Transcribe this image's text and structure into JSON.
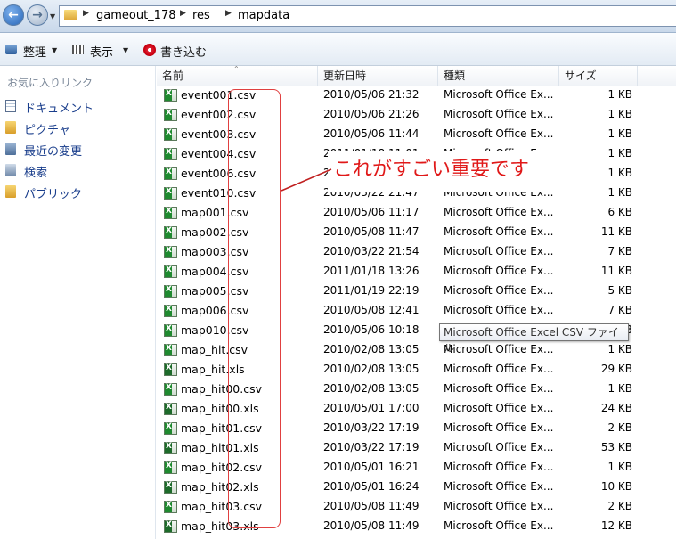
{
  "address": {
    "crumbs": [
      "gameout_178",
      "res",
      "mapdata"
    ]
  },
  "toolbar": {
    "organize_label": "整理",
    "view_label": "表示",
    "burn_label": "書き込む"
  },
  "navpane": {
    "heading": "お気に入りリンク",
    "items": [
      {
        "label": "ドキュメント",
        "icon": "document-icon"
      },
      {
        "label": "ピクチャ",
        "icon": "pictures-folder-icon"
      },
      {
        "label": "最近の変更",
        "icon": "recent-changes-icon"
      },
      {
        "label": "検索",
        "icon": "search-folder-icon"
      },
      {
        "label": "パブリック",
        "icon": "public-folder-icon"
      }
    ]
  },
  "columns": {
    "name": "名前",
    "date": "更新日時",
    "type": "種類",
    "size": "サイズ"
  },
  "files": [
    {
      "name": "event001.csv",
      "date": "2010/05/06 21:32",
      "type": "Microsoft Office Ex...",
      "size": "1 KB"
    },
    {
      "name": "event002.csv",
      "date": "2010/05/06 21:26",
      "type": "Microsoft Office Ex...",
      "size": "1 KB"
    },
    {
      "name": "event003.csv",
      "date": "2010/05/06 11:44",
      "type": "Microsoft Office Ex...",
      "size": "1 KB"
    },
    {
      "name": "event004.csv",
      "date": "2011/01/18 11:01",
      "type": "Microsoft Office Ex...",
      "size": "1 KB"
    },
    {
      "name": "event006.csv",
      "date": "2010/05/06 21:41",
      "type": "Microsoft Office Ex...",
      "size": "1 KB"
    },
    {
      "name": "event010.csv",
      "date": "2010/03/22 21:47",
      "type": "Microsoft Office Ex...",
      "size": "1 KB"
    },
    {
      "name": "map001.csv",
      "date": "2010/05/06 11:17",
      "type": "Microsoft Office Ex...",
      "size": "6 KB"
    },
    {
      "name": "map002.csv",
      "date": "2010/05/08 11:47",
      "type": "Microsoft Office Ex...",
      "size": "11 KB"
    },
    {
      "name": "map003.csv",
      "date": "2010/03/22 21:54",
      "type": "Microsoft Office Ex...",
      "size": "7 KB"
    },
    {
      "name": "map004.csv",
      "date": "2011/01/18 13:26",
      "type": "Microsoft Office Ex...",
      "size": "11 KB"
    },
    {
      "name": "map005.csv",
      "date": "2011/01/19 22:19",
      "type": "Microsoft Office Ex...",
      "size": "5 KB"
    },
    {
      "name": "map006.csv",
      "date": "2010/05/08 12:41",
      "type": "Microsoft Office Ex...",
      "size": "7 KB"
    },
    {
      "name": "map010.csv",
      "date": "2010/05/06 10:18",
      "type": "",
      "size": "1 KB"
    },
    {
      "name": "map_hit.csv",
      "date": "2010/02/08 13:05",
      "type": "Microsoft Office Ex...",
      "size": "1 KB"
    },
    {
      "name": "map_hit.xls",
      "date": "2010/02/08 13:05",
      "type": "Microsoft Office Ex...",
      "size": "29 KB"
    },
    {
      "name": "map_hit00.csv",
      "date": "2010/02/08 13:05",
      "type": "Microsoft Office Ex...",
      "size": "1 KB"
    },
    {
      "name": "map_hit00.xls",
      "date": "2010/05/01 17:00",
      "type": "Microsoft Office Ex...",
      "size": "24 KB"
    },
    {
      "name": "map_hit01.csv",
      "date": "2010/03/22 17:19",
      "type": "Microsoft Office Ex...",
      "size": "2 KB"
    },
    {
      "name": "map_hit01.xls",
      "date": "2010/03/22 17:19",
      "type": "Microsoft Office Ex...",
      "size": "53 KB"
    },
    {
      "name": "map_hit02.csv",
      "date": "2010/05/01 16:21",
      "type": "Microsoft Office Ex...",
      "size": "1 KB"
    },
    {
      "name": "map_hit02.xls",
      "date": "2010/05/01 16:24",
      "type": "Microsoft Office Ex...",
      "size": "10 KB"
    },
    {
      "name": "map_hit03.csv",
      "date": "2010/05/08 11:49",
      "type": "Microsoft Office Ex...",
      "size": "2 KB"
    },
    {
      "name": "map_hit03.xls",
      "date": "2010/05/08 11:49",
      "type": "Microsoft Office Ex...",
      "size": "12 KB"
    }
  ],
  "tooltip": "Microsoft Office Excel CSV ファイル",
  "annotation": "これがすごい重要です",
  "colors": {
    "annotation": "#e01818",
    "excel_green": "#1f8a2f",
    "link_blue": "#1a3e8c"
  }
}
